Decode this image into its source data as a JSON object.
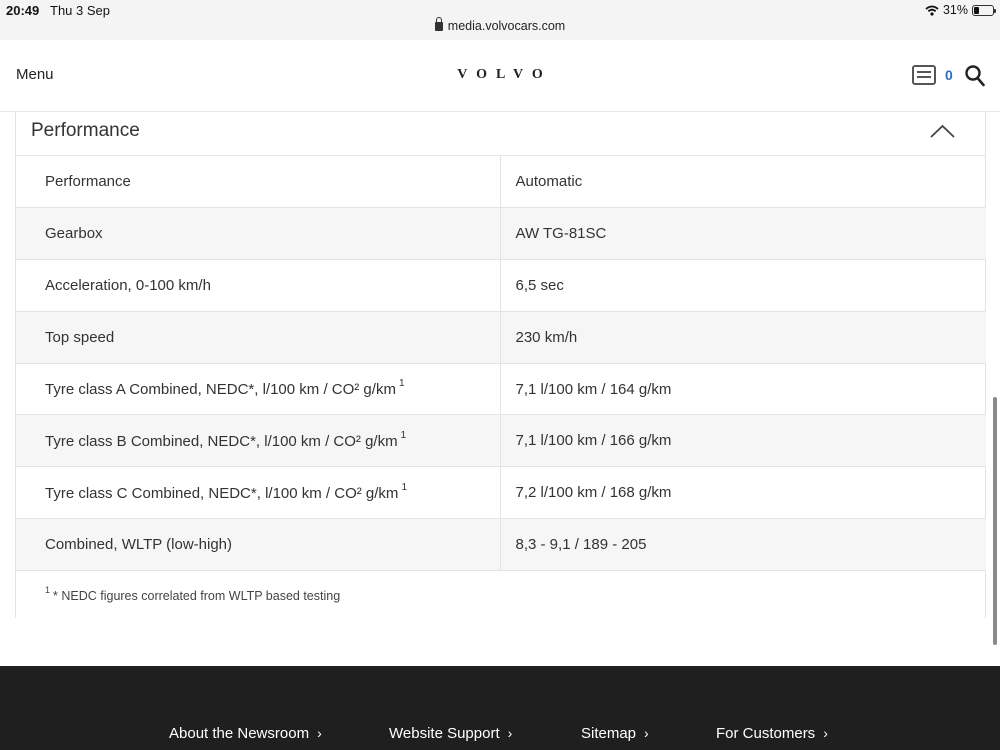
{
  "status_bar": {
    "time": "20:49",
    "date": "Thu 3 Sep",
    "url": "media.volvocars.com",
    "battery": "31%"
  },
  "header": {
    "menu_label": "Menu",
    "logo_text": "VOLVO",
    "cart_count": "0"
  },
  "section": {
    "title": "Performance",
    "rows": [
      {
        "label": "Performance",
        "sup": "",
        "value": "Automatic"
      },
      {
        "label": "Gearbox",
        "sup": "",
        "value": "AW TG-81SC"
      },
      {
        "label": "Acceleration, 0-100 km/h",
        "sup": "",
        "value": "6,5 sec"
      },
      {
        "label": "Top speed",
        "sup": "",
        "value": "230 km/h"
      },
      {
        "label": "Tyre class A Combined, NEDC*, l/100 km / CO² g/km",
        "sup": "1",
        "value": "7,1 l/100 km / 164 g/km"
      },
      {
        "label": "Tyre class B Combined, NEDC*, l/100 km / CO² g/km",
        "sup": "1",
        "value": "7,1 l/100 km / 166 g/km"
      },
      {
        "label": "Tyre class C Combined, NEDC*, l/100 km / CO² g/km",
        "sup": "1",
        "value": "7,2 l/100 km / 168 g/km"
      },
      {
        "label": "Combined, WLTP (low-high)",
        "sup": "",
        "value": "8,3 - 9,1 / 189 - 205"
      }
    ],
    "footnote_mark": "1",
    "footnote_text": "* NEDC figures correlated from WLTP based testing"
  },
  "footer": {
    "links": [
      {
        "label": "About the Newsroom"
      },
      {
        "label": "Website Support"
      },
      {
        "label": "Sitemap"
      },
      {
        "label": "For Customers"
      }
    ]
  },
  "icons": [
    "lock-icon",
    "wifi-icon",
    "battery-icon",
    "cart-icon",
    "search-icon",
    "chevron-up-icon",
    "chevron-right-icon"
  ]
}
